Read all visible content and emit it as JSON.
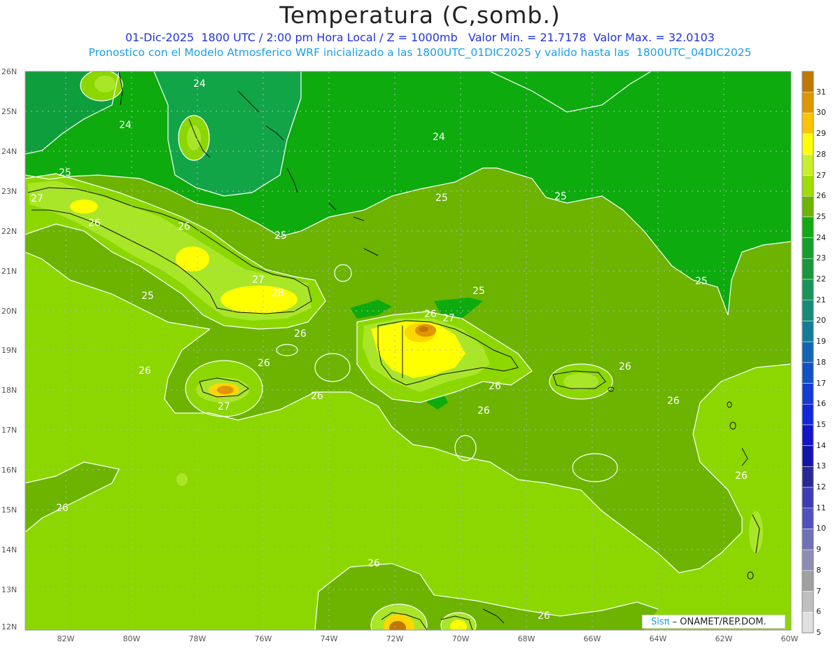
{
  "title": "Temperatura (C,somb.)",
  "subtitle_line1": "01-Dic-2025  1800 UTC / 2:00 pm Hora Local / Z = 1000mb   Valor Min. = 21.7178  Valor Max. = 32.0103",
  "subtitle_line2": "Pronostico con el Modelo Atmosferico WRF inicializado a las 1800UTC_01DIC2025 y valido hasta las  1800UTC_04DIC2025",
  "branding": {
    "sis": "Sisπ",
    "rest": " – ONAMET/REP.DOM."
  },
  "lat_labels": [
    "26N",
    "25N",
    "24N",
    "23N",
    "22N",
    "21N",
    "20N",
    "19N",
    "18N",
    "17N",
    "16N",
    "15N",
    "14N",
    "13N",
    "12N"
  ],
  "lon_labels": [
    "82W",
    "80W",
    "78W",
    "76W",
    "74W",
    "72W",
    "70W",
    "68W",
    "66W",
    "64W",
    "62W",
    "60W"
  ],
  "colorbar": {
    "values": [
      "31",
      "30",
      "29",
      "28",
      "27",
      "26",
      "25",
      "24",
      "23",
      "22",
      "21",
      "20",
      "19",
      "18",
      "17",
      "16",
      "15",
      "14",
      "13",
      "12",
      "11",
      "10",
      "9",
      "8",
      "7",
      "6",
      "5"
    ],
    "colors": [
      "#c07800",
      "#e09600",
      "#ffc400",
      "#ffff00",
      "#c8f028",
      "#a0dc00",
      "#6cb400",
      "#12aa12",
      "#14a028",
      "#1a963c",
      "#17945a",
      "#148c78",
      "#127c96",
      "#1264b4",
      "#1250c8",
      "#123cd2",
      "#1228dc",
      "#1414c8",
      "#1414aa",
      "#282896",
      "#3c3cb4",
      "#5050c0",
      "#7070b8",
      "#8c8cb4",
      "#a0a0a0",
      "#c0c0c0",
      "#e0e0e0"
    ]
  },
  "palette": {
    "t23": "#0f9e3c",
    "t24": "#0dab0d",
    "t25": "#6cb400",
    "t26": "#8cd700",
    "t27": "#aae628",
    "t28": "#ffff00",
    "t29": "#ffd700",
    "t30": "#e09600",
    "t31": "#c07800"
  },
  "contour_labels": [
    {
      "text": "24"
    },
    {
      "text": "24"
    },
    {
      "text": "24"
    },
    {
      "text": "25"
    },
    {
      "text": "25"
    },
    {
      "text": "25"
    },
    {
      "text": "25"
    },
    {
      "text": "25"
    },
    {
      "text": "25"
    },
    {
      "text": "25"
    },
    {
      "text": "26"
    },
    {
      "text": "26"
    },
    {
      "text": "26"
    },
    {
      "text": "26"
    },
    {
      "text": "26"
    },
    {
      "text": "26"
    },
    {
      "text": "26"
    },
    {
      "text": "26"
    },
    {
      "text": "26"
    },
    {
      "text": "26"
    },
    {
      "text": "26"
    },
    {
      "text": "26"
    },
    {
      "text": "26"
    },
    {
      "text": "26"
    },
    {
      "text": "27"
    },
    {
      "text": "27"
    },
    {
      "text": "27"
    },
    {
      "text": "27"
    },
    {
      "text": "28"
    }
  ]
}
